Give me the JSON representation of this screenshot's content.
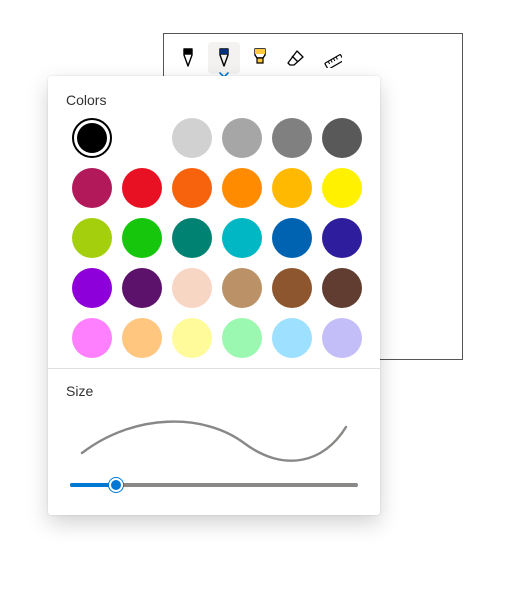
{
  "toolbar": {
    "tools": [
      {
        "name": "pen-black",
        "color": "#000000",
        "type": "pen",
        "selected": false
      },
      {
        "name": "pen-blue",
        "color": "#02307a",
        "type": "pen",
        "selected": true
      },
      {
        "name": "highlighter",
        "color": "#ffc83d",
        "type": "highlighter",
        "selected": false
      },
      {
        "name": "eraser",
        "color": "#000000",
        "type": "eraser",
        "selected": false
      },
      {
        "name": "ruler",
        "color": "#000000",
        "type": "ruler",
        "selected": false
      }
    ],
    "chevron_color": "#0078d4"
  },
  "popup": {
    "colors_label": "Colors",
    "size_label": "Size",
    "selected_color_index": 0,
    "colors": [
      [
        "#000000",
        "#ffffff",
        "#d1d1d1",
        "#a6a6a6",
        "#808080",
        "#595959"
      ],
      [
        "#b1195b",
        "#e81123",
        "#f7630c",
        "#ff8c00",
        "#ffb900",
        "#fff100"
      ],
      [
        "#a4cf0c",
        "#16c60c",
        "#008272",
        "#00b7c3",
        "#0063b1",
        "#2e1d9c"
      ],
      [
        "#8e00d9",
        "#5c126b",
        "#f7d7c4",
        "#bb9167",
        "#8e562e",
        "#603d30"
      ],
      [
        "#ff80ff",
        "#ffc680",
        "#fffb9a",
        "#9af8b0",
        "#9ee0ff",
        "#c3bef7"
      ]
    ],
    "slider": {
      "min": 1,
      "max": 100,
      "value": 16
    },
    "stroke_preview_color": "#8a8886"
  }
}
